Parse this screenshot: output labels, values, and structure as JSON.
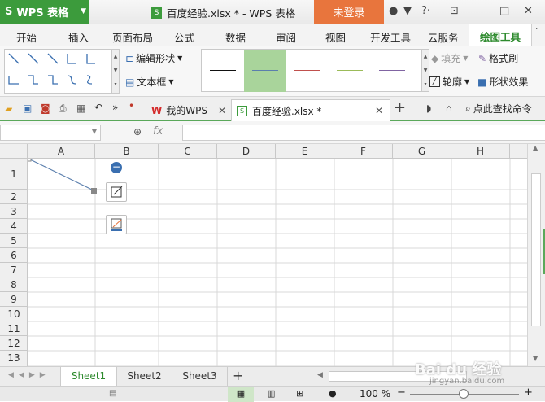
{
  "app": {
    "name": "WPS 表格",
    "doc_title": "百度经验.xlsx * - WPS 表格",
    "login": "未登录"
  },
  "menus": [
    "开始",
    "插入",
    "页面布局",
    "公式",
    "数据",
    "审阅",
    "视图",
    "开发工具",
    "云服务"
  ],
  "active_menu": "绘图工具",
  "ribbon": {
    "edit_shape": "编辑形状",
    "text_box": "文本框",
    "fill": "填充",
    "format_brush": "格式刷",
    "outline": "轮廓",
    "shape_effect": "形状效果"
  },
  "tabs": {
    "wps": "我的WPS",
    "doc": "百度经验.xlsx *",
    "search": "点此查找命令"
  },
  "formula": {
    "fx": "fx"
  },
  "columns": [
    "A",
    "B",
    "C",
    "D",
    "E",
    "F",
    "G",
    "H"
  ],
  "rows": [
    "1",
    "2",
    "3",
    "4",
    "5",
    "6",
    "7",
    "8",
    "9",
    "10",
    "11",
    "12",
    "13"
  ],
  "sheets": [
    "Sheet1",
    "Sheet2",
    "Sheet3"
  ],
  "status": {
    "zoom": "100 %"
  },
  "watermark": {
    "brand": "Bai du 经验",
    "url": "jingyan.baidu.com"
  },
  "colors": {
    "accent": "#3c9b3c",
    "login": "#e8753d",
    "line": "#5b7fad"
  }
}
